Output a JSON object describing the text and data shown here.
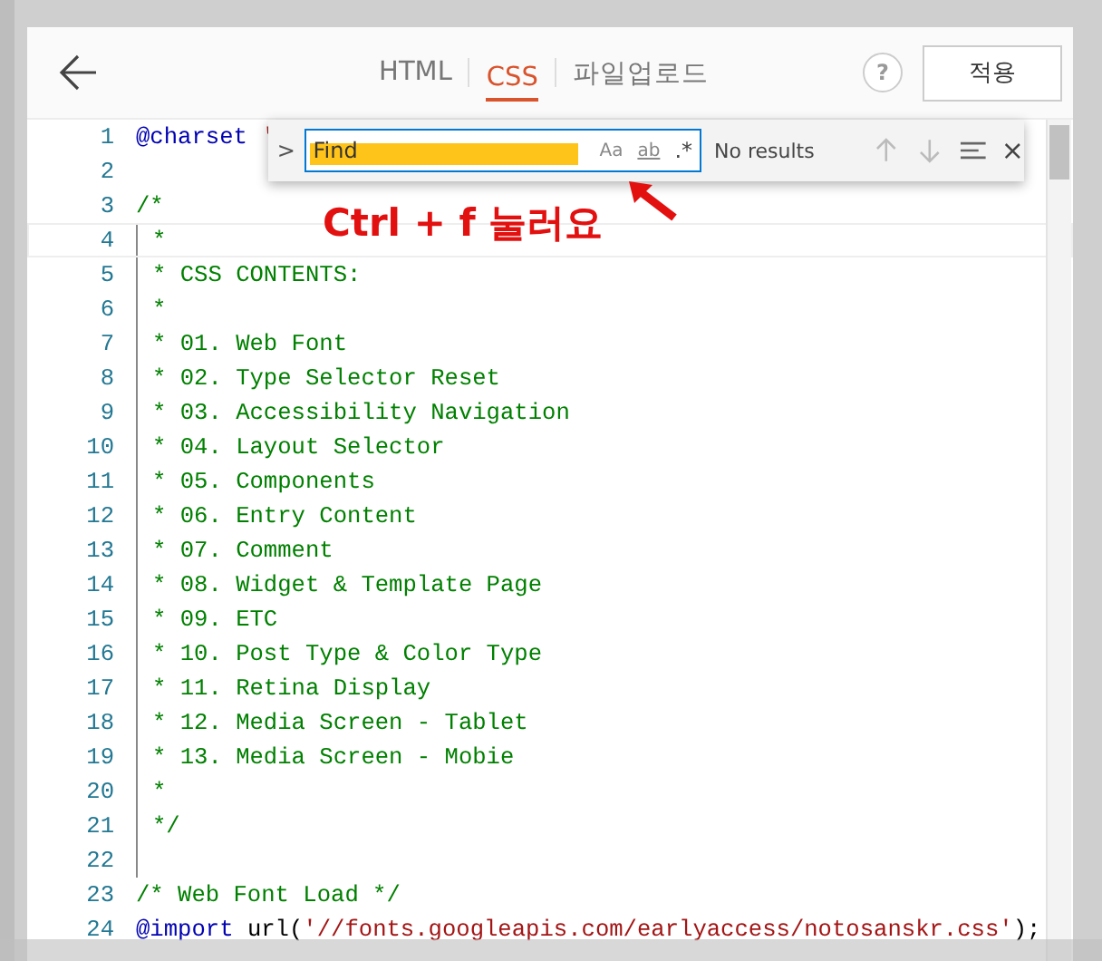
{
  "header": {
    "tabs": [
      {
        "label": "HTML",
        "selected": false
      },
      {
        "label": "CSS",
        "selected": true
      },
      {
        "label": "파일업로드",
        "selected": false
      }
    ],
    "help": "?",
    "apply_button": "적용"
  },
  "find_widget": {
    "toggle": ">",
    "placeholder": "Find",
    "match_case": "Aa",
    "whole_word": "ab",
    "regex": ".*",
    "status": "No results",
    "close": "×"
  },
  "annotation": {
    "text": "Ctrl + f 눌러요"
  },
  "editor": {
    "lines": [
      {
        "number": "1",
        "indent_guide": false,
        "tokens": [
          {
            "text": "@charset",
            "kind": "keyword"
          },
          {
            "text": " '",
            "kind": "string"
          }
        ]
      },
      {
        "number": "2",
        "indent_guide": false
      },
      {
        "number": "3",
        "indent_guide": false,
        "tokens": [
          {
            "text": "/*",
            "kind": "comment"
          }
        ]
      },
      {
        "number": "4",
        "indent_guide": true,
        "tokens": [
          {
            "text": "*",
            "kind": "comment"
          }
        ]
      },
      {
        "number": "5",
        "indent_guide": true,
        "tokens": [
          {
            "text": "* CSS CONTENTS:",
            "kind": "comment"
          }
        ]
      },
      {
        "number": "6",
        "indent_guide": true,
        "tokens": [
          {
            "text": "*",
            "kind": "comment"
          }
        ]
      },
      {
        "number": "7",
        "indent_guide": true,
        "tokens": [
          {
            "text": "* 01. Web Font",
            "kind": "comment"
          }
        ]
      },
      {
        "number": "8",
        "indent_guide": true,
        "tokens": [
          {
            "text": "* 02. Type Selector Reset",
            "kind": "comment"
          }
        ]
      },
      {
        "number": "9",
        "indent_guide": true,
        "tokens": [
          {
            "text": "* 03. Accessibility Navigation",
            "kind": "comment"
          }
        ]
      },
      {
        "number": "10",
        "indent_guide": true,
        "tokens": [
          {
            "text": "* 04. Layout Selector",
            "kind": "comment"
          }
        ]
      },
      {
        "number": "11",
        "indent_guide": true,
        "tokens": [
          {
            "text": "* 05. Components",
            "kind": "comment"
          }
        ]
      },
      {
        "number": "12",
        "indent_guide": true,
        "tokens": [
          {
            "text": "* 06. Entry Content",
            "kind": "comment"
          }
        ]
      },
      {
        "number": "13",
        "indent_guide": true,
        "tokens": [
          {
            "text": "* 07. Comment",
            "kind": "comment"
          }
        ]
      },
      {
        "number": "14",
        "indent_guide": true,
        "tokens": [
          {
            "text": "* 08. Widget & Template Page",
            "kind": "comment"
          }
        ]
      },
      {
        "number": "15",
        "indent_guide": true,
        "tokens": [
          {
            "text": "* 09. ETC",
            "kind": "comment"
          }
        ]
      },
      {
        "number": "16",
        "indent_guide": true,
        "tokens": [
          {
            "text": "* 10. Post Type & Color Type",
            "kind": "comment"
          }
        ]
      },
      {
        "number": "17",
        "indent_guide": true,
        "tokens": [
          {
            "text": "* 11. Retina Display",
            "kind": "comment"
          }
        ]
      },
      {
        "number": "18",
        "indent_guide": true,
        "tokens": [
          {
            "text": "* 12. Media Screen - Tablet",
            "kind": "comment"
          }
        ]
      },
      {
        "number": "19",
        "indent_guide": true,
        "tokens": [
          {
            "text": "* 13. Media Screen - Mobie",
            "kind": "comment"
          }
        ]
      },
      {
        "number": "20",
        "indent_guide": true,
        "tokens": [
          {
            "text": "*",
            "kind": "comment"
          }
        ]
      },
      {
        "number": "21",
        "indent_guide": true,
        "tokens": [
          {
            "text": "*/",
            "kind": "comment"
          }
        ]
      },
      {
        "number": "22",
        "indent_guide": true
      },
      {
        "number": "23",
        "indent_guide": false,
        "tokens": [
          {
            "text": "/* Web Font Load */",
            "kind": "comment"
          }
        ]
      },
      {
        "number": "24",
        "indent_guide": false,
        "tokens": [
          {
            "text": "@import",
            "kind": "keyword"
          },
          {
            "text": " url(",
            "kind": "plain"
          },
          {
            "text": "'//fonts.googleapis.com/earlyaccess/notosanskr.css'",
            "kind": "string"
          },
          {
            "text": ");",
            "kind": "plain"
          }
        ]
      }
    ]
  }
}
